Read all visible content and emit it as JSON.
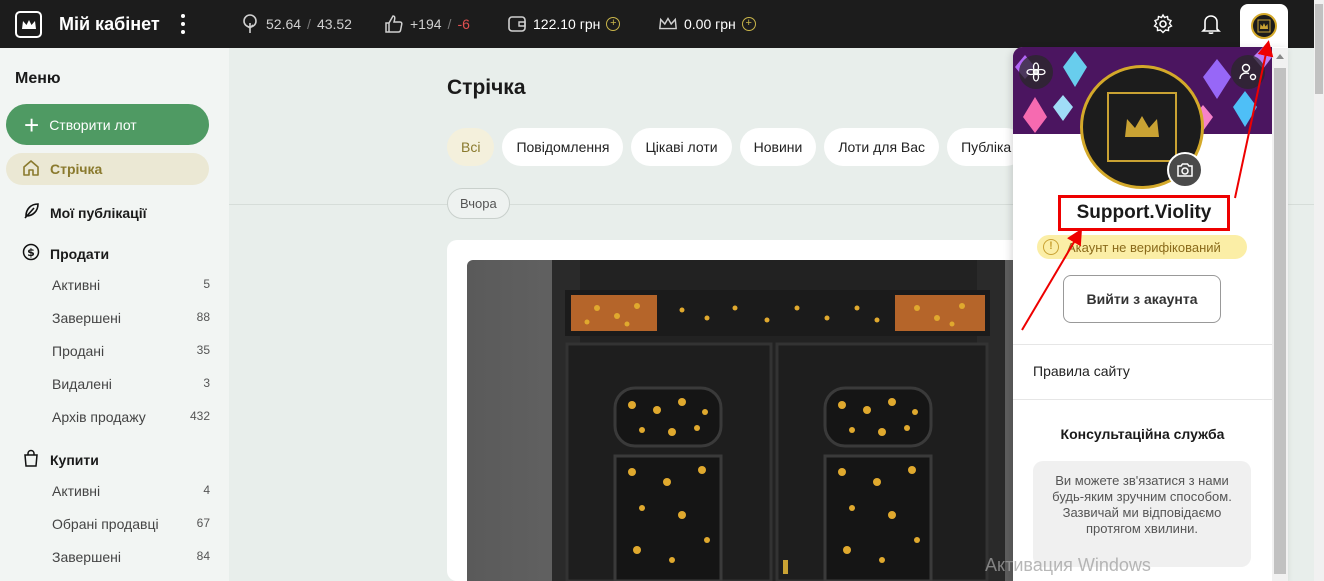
{
  "topbar": {
    "title": "Мій кабінет",
    "rating_pos": "52.64",
    "rating_sep": "/",
    "rating_neg": "43.52",
    "likes_pos": "+194",
    "likes_sep": "/",
    "likes_neg": "-6",
    "wallet": "122.10 грн",
    "crown_balance": "0.00 грн",
    "plus": "+"
  },
  "sidebar": {
    "menu_title": "Меню",
    "create_lot": "Створити лот",
    "feed": "Стрічка",
    "my_publications": "Мої публікації",
    "sell": {
      "label": "Продати",
      "items": [
        {
          "label": "Активні",
          "count": "5"
        },
        {
          "label": "Завершені",
          "count": "88"
        },
        {
          "label": "Продані",
          "count": "35"
        },
        {
          "label": "Видалені",
          "count": "3"
        },
        {
          "label": "Архів продажу",
          "count": "432"
        }
      ]
    },
    "buy": {
      "label": "Купити",
      "items": [
        {
          "label": "Активні",
          "count": "4"
        },
        {
          "label": "Обрані продавці",
          "count": "67"
        },
        {
          "label": "Завершені",
          "count": "84"
        }
      ]
    }
  },
  "main": {
    "title": "Стрічка",
    "chips": [
      "Всі",
      "Повідомлення",
      "Цікаві лоти",
      "Новини",
      "Лоти для Вас",
      "Публіка"
    ],
    "date_label": "Вчора"
  },
  "panel": {
    "username": "Support.Violity",
    "verify_status": "Акаунт не верифікований",
    "verify_icon": "!",
    "logout": "Вийти з акаунта",
    "rules": "Правила сайту",
    "consult_title": "Консультаційна служба",
    "consult_text": "Ви можете зв'язатися з нами будь-яким зручним способом. Зазвичай ми відповідаємо протягом хвилини."
  },
  "watermark": "Активация Windows",
  "colors": {
    "topbar_bg": "#1c1c1c",
    "accent_green": "#4f9a63",
    "accent_gold": "#d4a92a",
    "negative": "#e05050",
    "annotation_red": "#e00000"
  }
}
